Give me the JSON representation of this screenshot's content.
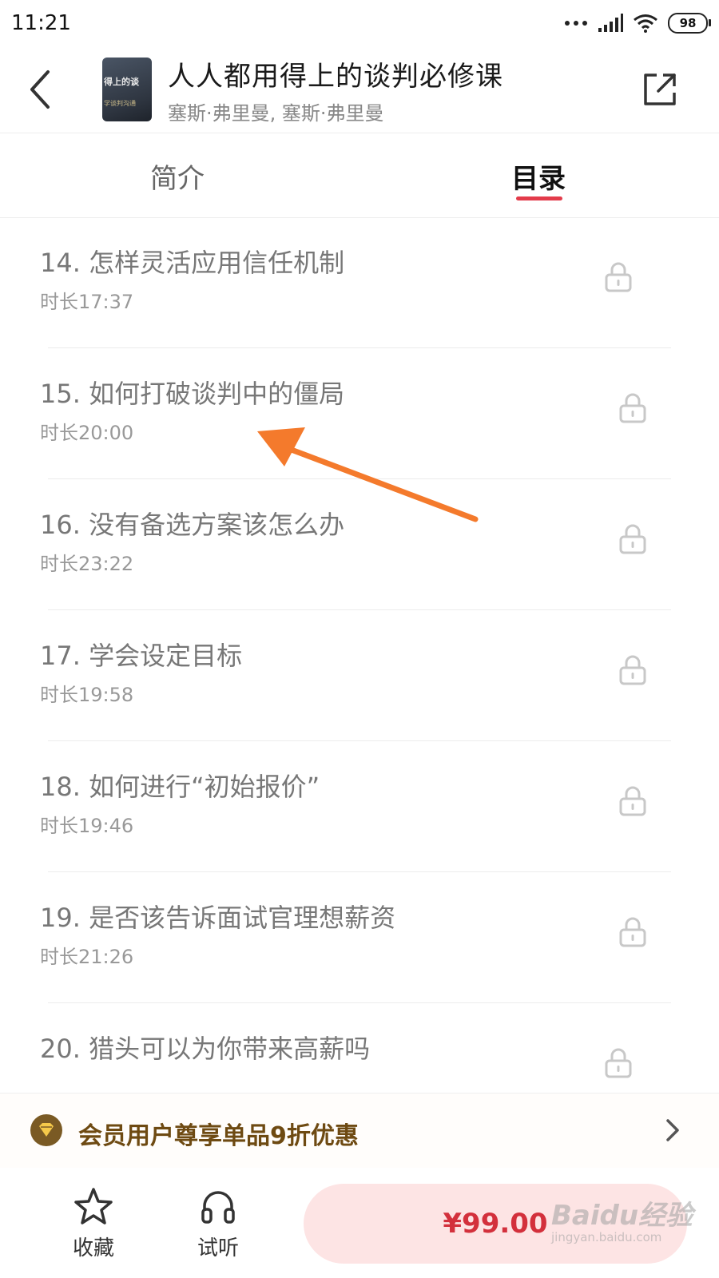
{
  "status_bar": {
    "time": "11:21",
    "battery": "98"
  },
  "header": {
    "title": "人人都用得上的谈判必修课",
    "author": "塞斯·弗里曼, 塞斯·弗里曼",
    "cover_text_1": "得上的谈",
    "cover_text_2": "学谈判沟通"
  },
  "tabs": [
    {
      "label": "简介",
      "active": false
    },
    {
      "label": "目录",
      "active": true
    }
  ],
  "list": {
    "items": [
      {
        "title": "14. 怎样灵活应用信任机制",
        "duration": "时长17:37",
        "locked": true
      },
      {
        "title": "15. 如何打破谈判中的僵局",
        "duration": "时长20:00",
        "locked": true
      },
      {
        "title": "16. 没有备选方案该怎么办",
        "duration": "时长23:22",
        "locked": true
      },
      {
        "title": "17. 学会设定目标",
        "duration": "时长19:58",
        "locked": true
      },
      {
        "title": "18. 如何进行“初始报价”",
        "duration": "时长19:46",
        "locked": true
      },
      {
        "title": "19. 是否该告诉面试官理想薪资",
        "duration": "时长21:26",
        "locked": true
      },
      {
        "title": "20. 猎头可以为你带来高薪吗",
        "duration": "",
        "locked": true
      }
    ]
  },
  "promo": {
    "text": "会员用户尊享单品9折优惠"
  },
  "bottom_bar": {
    "favorite_label": "收藏",
    "listen_label": "试听",
    "buy_price": "¥99.00"
  },
  "watermark": {
    "main": "Baidu经验",
    "sub": "jingyan.baidu.com"
  },
  "colors": {
    "accent": "#e33b4a",
    "annotation_arrow": "#f47a2c",
    "promo_text": "#6e4a12",
    "buy_bg": "#fde4e4"
  }
}
